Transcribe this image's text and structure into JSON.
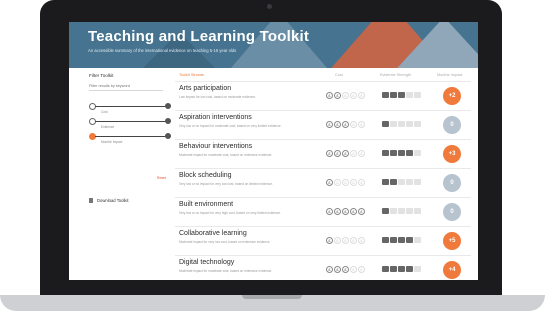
{
  "hero": {
    "title": "Teaching and Learning Toolkit",
    "subtitle": "An accessible summary of the international evidence on teaching 5-16 year olds"
  },
  "sidebar": {
    "filter_title": "Filter Toolkit",
    "search_placeholder": "Filter results by keyword",
    "sliders": [
      {
        "icon": "cost-coin-icon",
        "label": "Cost"
      },
      {
        "icon": "evidence-pad-icon",
        "label": "Evidence"
      },
      {
        "icon": "impact-circle-icon",
        "label": "Months' impact"
      }
    ],
    "reset": "Reset",
    "download": "Download Toolkit"
  },
  "columns": {
    "strand": "Toolkit Strands",
    "cost": "Cost",
    "evidence": "Evidence Strength",
    "impact": "Months' impact"
  },
  "rows": [
    {
      "title": "Arts participation",
      "desc": "Low impact for low cost, based on moderate evidence.",
      "cost": 2,
      "evidence": 3,
      "impact": "+2",
      "impact_color": "#ef7a3c"
    },
    {
      "title": "Aspiration interventions",
      "desc": "Very low or no impact for moderate cost, based on very limited evidence.",
      "cost": 3,
      "evidence": 1,
      "impact": "0",
      "impact_color": "#b7c4cf"
    },
    {
      "title": "Behaviour interventions",
      "desc": "Moderate impact for moderate cost, based on extensive evidence.",
      "cost": 3,
      "evidence": 4,
      "impact": "+3",
      "impact_color": "#ef7a3c"
    },
    {
      "title": "Block scheduling",
      "desc": "Very low or no impact for very low cost, based on limited evidence.",
      "cost": 1,
      "evidence": 2,
      "impact": "0",
      "impact_color": "#b7c4cf"
    },
    {
      "title": "Built environment",
      "desc": "Very low or no impact for very high cost, based on very limited evidence.",
      "cost": 5,
      "evidence": 1,
      "impact": "0",
      "impact_color": "#b7c4cf"
    },
    {
      "title": "Collaborative learning",
      "desc": "Moderate impact for very low cost, based on extensive evidence.",
      "cost": 1,
      "evidence": 4,
      "impact": "+5",
      "impact_color": "#ef7a3c"
    },
    {
      "title": "Digital technology",
      "desc": "Moderate impact for moderate cost, based on extensive evidence.",
      "cost": 3,
      "evidence": 4,
      "impact": "+4",
      "impact_color": "#ef7a3c"
    }
  ]
}
